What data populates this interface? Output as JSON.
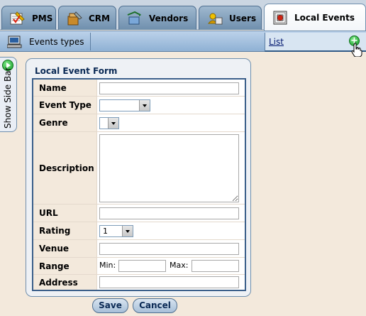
{
  "tabs": [
    {
      "label": "PMS",
      "icon": "pms-icon",
      "active": false
    },
    {
      "label": "CRM",
      "icon": "crm-icon",
      "active": false
    },
    {
      "label": "Vendors",
      "icon": "vendors-icon",
      "active": false
    },
    {
      "label": "Users",
      "icon": "users-icon",
      "active": false
    },
    {
      "label": "Local Events",
      "icon": "local-events-icon",
      "active": true
    }
  ],
  "subnav": {
    "events_types_label": "Events types",
    "list_label": "List",
    "add_icon": "add-icon"
  },
  "sidebar": {
    "toggle_label": "Show Side Bar"
  },
  "form": {
    "title": "Local Event Form",
    "fields": {
      "name": {
        "label": "Name",
        "value": ""
      },
      "event_type": {
        "label": "Event Type",
        "value": ""
      },
      "genre": {
        "label": "Genre",
        "value": ""
      },
      "description": {
        "label": "Description",
        "value": ""
      },
      "url": {
        "label": "URL",
        "value": ""
      },
      "rating": {
        "label": "Rating",
        "value": "1"
      },
      "venue": {
        "label": "Venue",
        "value": ""
      },
      "range": {
        "label": "Range",
        "min_label": "Min:",
        "max_label": "Max:",
        "min_value": "",
        "max_value": ""
      },
      "address": {
        "label": "Address",
        "value": ""
      }
    }
  },
  "buttons": {
    "save_label": "Save",
    "cancel_label": "Cancel"
  },
  "colors": {
    "accent": "#3b5f8a",
    "label_bg": "#f3e9dc",
    "page_bg": "#f3e9dc"
  }
}
